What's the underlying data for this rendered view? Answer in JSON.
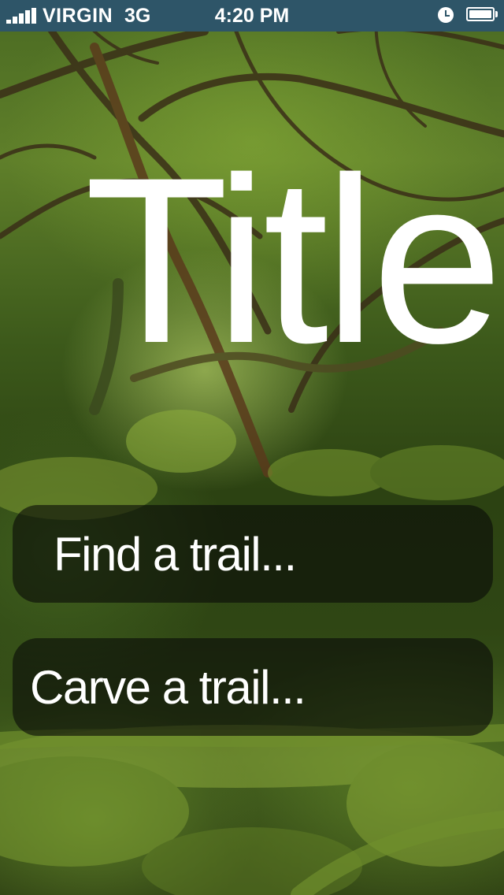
{
  "status_bar": {
    "carrier": "VIRGIN",
    "network": "3G",
    "time": "4:20 PM",
    "signal_icon": "signal-bars-icon",
    "alarm_icon": "alarm-clock-icon",
    "battery_icon": "battery-full-icon",
    "background_color": "#2e5568"
  },
  "main": {
    "title": "Title",
    "find_trail_label": "Find a trail...",
    "carve_trail_label": "Carve a trail..."
  }
}
